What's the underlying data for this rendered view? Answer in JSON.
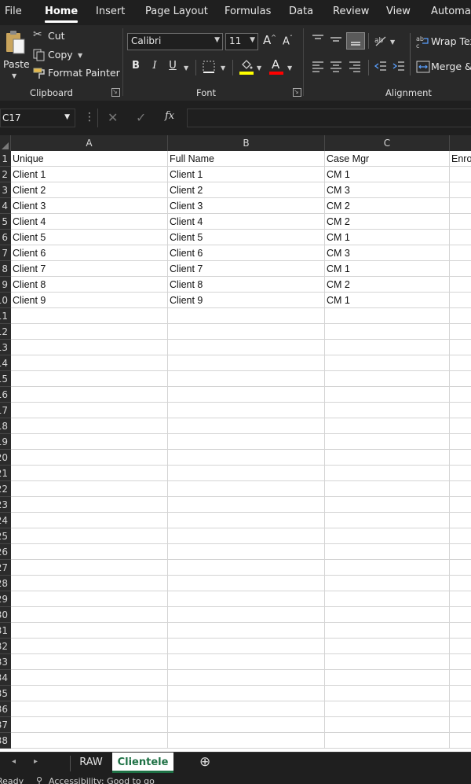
{
  "menu": {
    "tabs": [
      "File",
      "Home",
      "Insert",
      "Page Layout",
      "Formulas",
      "Data",
      "Review",
      "View",
      "Automate"
    ],
    "active": "Home"
  },
  "ribbon": {
    "clipboard": {
      "paste": "Paste",
      "cut": "Cut",
      "copy": "Copy",
      "format_painter": "Format Painter",
      "label": "Clipboard"
    },
    "font": {
      "name": "Calibri",
      "size": "11",
      "bold": "B",
      "italic": "I",
      "underline": "U",
      "label": "Font",
      "fill_color": "#ffff00",
      "font_color": "#ff0000"
    },
    "alignment": {
      "wrap_text": "Wrap Text",
      "merge": "Merge &",
      "label": "Alignment"
    }
  },
  "formula_bar": {
    "name_box": "C17",
    "formula": ""
  },
  "grid": {
    "columns": [
      "A",
      "B",
      "C"
    ],
    "rows": [
      {
        "num": "1",
        "cells": [
          "Unique",
          "Full Name",
          "Case Mgr",
          "Enro"
        ]
      },
      {
        "num": "2",
        "cells": [
          "Client 1",
          "Client 1",
          "CM 1",
          ""
        ]
      },
      {
        "num": "3",
        "cells": [
          "Client 2",
          "Client 2",
          "CM 3",
          ""
        ]
      },
      {
        "num": "4",
        "cells": [
          "Client 3",
          "Client 3",
          "CM 2",
          ""
        ]
      },
      {
        "num": "5",
        "cells": [
          "Client 4",
          "Client 4",
          "CM 2",
          ""
        ]
      },
      {
        "num": "6",
        "cells": [
          "Client 5",
          "Client 5",
          "CM 1",
          ""
        ]
      },
      {
        "num": "7",
        "cells": [
          "Client 6",
          "Client 6",
          "CM 3",
          ""
        ]
      },
      {
        "num": "8",
        "cells": [
          "Client 7",
          "Client 7",
          "CM 1",
          ""
        ]
      },
      {
        "num": "9",
        "cells": [
          "Client 8",
          "Client 8",
          "CM 2",
          ""
        ]
      },
      {
        "num": "10",
        "cells": [
          "Client 9",
          "Client 9",
          "CM 1",
          ""
        ]
      },
      {
        "num": "11",
        "cells": [
          "",
          "",
          "",
          ""
        ]
      },
      {
        "num": "12",
        "cells": [
          "",
          "",
          "",
          ""
        ]
      },
      {
        "num": "13",
        "cells": [
          "",
          "",
          "",
          ""
        ]
      },
      {
        "num": "14",
        "cells": [
          "",
          "",
          "",
          ""
        ]
      },
      {
        "num": "15",
        "cells": [
          "",
          "",
          "",
          ""
        ]
      },
      {
        "num": "16",
        "cells": [
          "",
          "",
          "",
          ""
        ]
      },
      {
        "num": "17",
        "cells": [
          "",
          "",
          "",
          ""
        ]
      },
      {
        "num": "18",
        "cells": [
          "",
          "",
          "",
          ""
        ]
      },
      {
        "num": "19",
        "cells": [
          "",
          "",
          "",
          ""
        ]
      },
      {
        "num": "20",
        "cells": [
          "",
          "",
          "",
          ""
        ]
      },
      {
        "num": "21",
        "cells": [
          "",
          "",
          "",
          ""
        ]
      },
      {
        "num": "22",
        "cells": [
          "",
          "",
          "",
          ""
        ]
      },
      {
        "num": "23",
        "cells": [
          "",
          "",
          "",
          ""
        ]
      },
      {
        "num": "24",
        "cells": [
          "",
          "",
          "",
          ""
        ]
      },
      {
        "num": "25",
        "cells": [
          "",
          "",
          "",
          ""
        ]
      },
      {
        "num": "26",
        "cells": [
          "",
          "",
          "",
          ""
        ]
      },
      {
        "num": "27",
        "cells": [
          "",
          "",
          "",
          ""
        ]
      },
      {
        "num": "28",
        "cells": [
          "",
          "",
          "",
          ""
        ]
      },
      {
        "num": "29",
        "cells": [
          "",
          "",
          "",
          ""
        ]
      },
      {
        "num": "30",
        "cells": [
          "",
          "",
          "",
          ""
        ]
      },
      {
        "num": "31",
        "cells": [
          "",
          "",
          "",
          ""
        ]
      },
      {
        "num": "32",
        "cells": [
          "",
          "",
          "",
          ""
        ]
      },
      {
        "num": "33",
        "cells": [
          "",
          "",
          "",
          ""
        ]
      },
      {
        "num": "34",
        "cells": [
          "",
          "",
          "",
          ""
        ]
      },
      {
        "num": "35",
        "cells": [
          "",
          "",
          "",
          ""
        ]
      },
      {
        "num": "36",
        "cells": [
          "",
          "",
          "",
          ""
        ]
      },
      {
        "num": "37",
        "cells": [
          "",
          "",
          "",
          ""
        ]
      },
      {
        "num": "38",
        "cells": [
          "",
          "",
          "",
          ""
        ]
      }
    ]
  },
  "sheets": {
    "tabs": [
      "RAW",
      "Clientele"
    ],
    "active": "Clientele"
  },
  "status": {
    "ready": "Ready",
    "accessibility": "Accessibility: Good to go"
  },
  "colors": {
    "accent": "#1e7145"
  }
}
